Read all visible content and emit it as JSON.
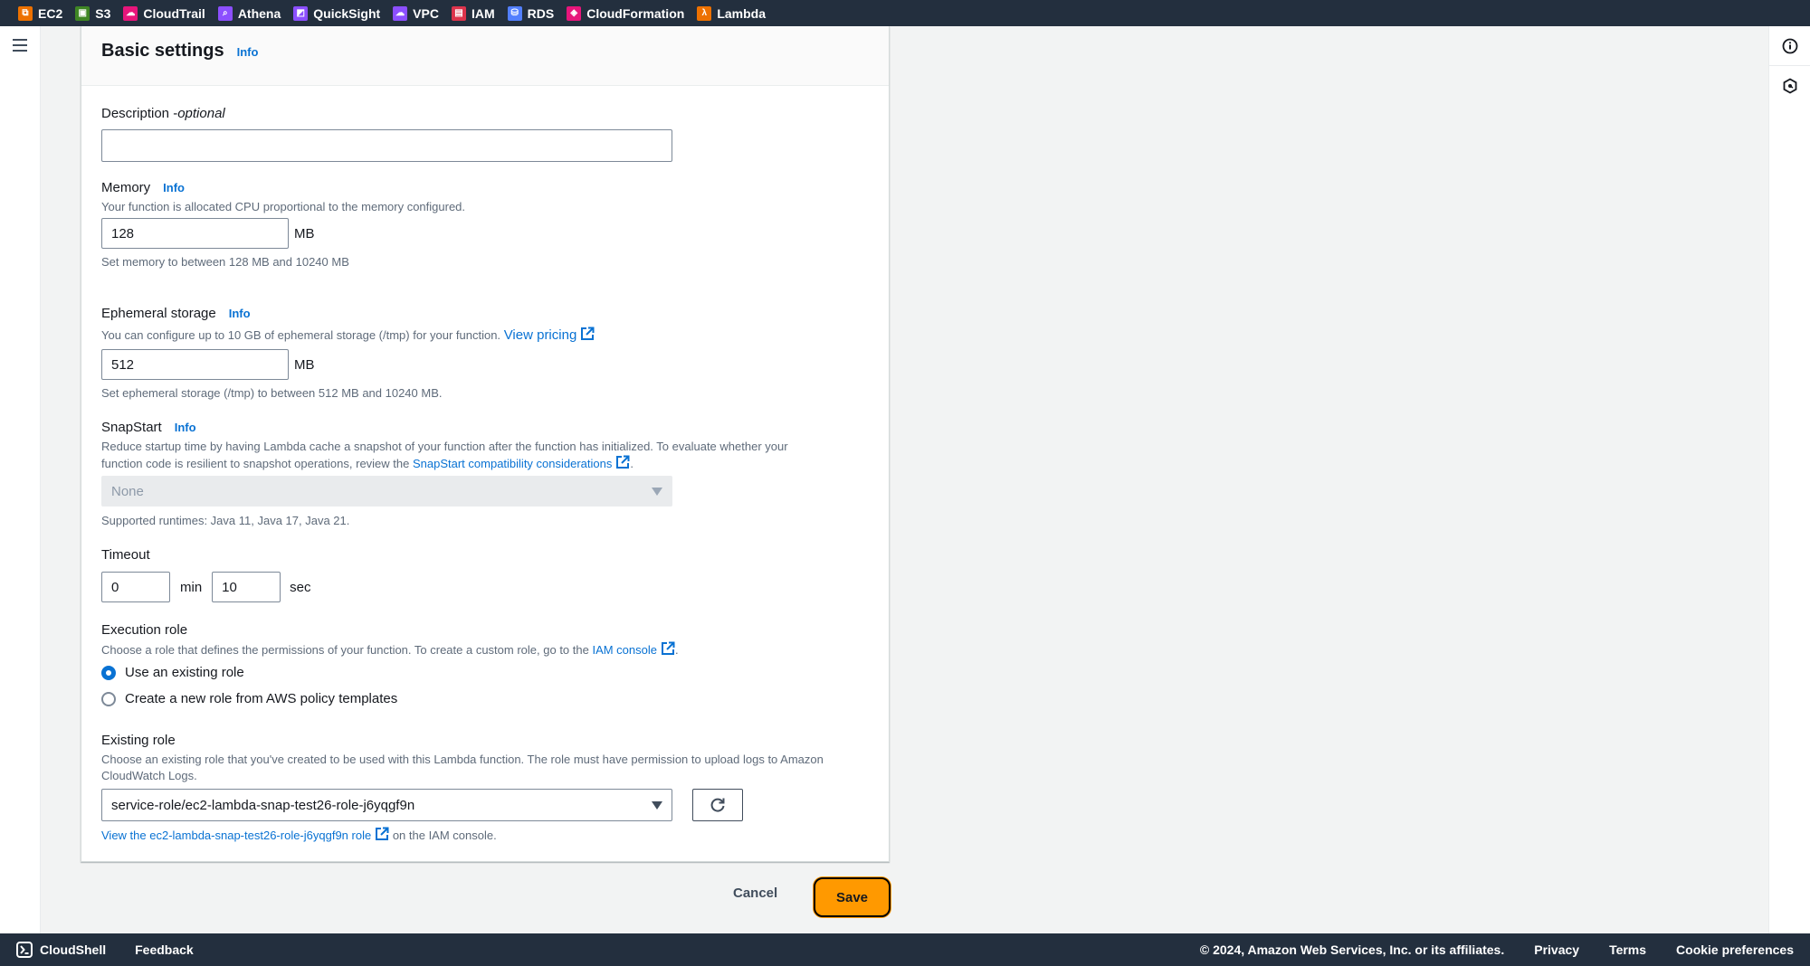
{
  "topbar": {
    "services": [
      {
        "label": "EC2",
        "icon": "ec2-icon",
        "color": "#ed7100"
      },
      {
        "label": "S3",
        "icon": "s3-icon",
        "color": "#3f8624"
      },
      {
        "label": "CloudTrail",
        "icon": "cloudtrail-icon",
        "color": "#e7157b"
      },
      {
        "label": "Athena",
        "icon": "athena-icon",
        "color": "#8c4fff"
      },
      {
        "label": "QuickSight",
        "icon": "quicksight-icon",
        "color": "#8c4fff"
      },
      {
        "label": "VPC",
        "icon": "vpc-icon",
        "color": "#8c4fff"
      },
      {
        "label": "IAM",
        "icon": "iam-icon",
        "color": "#dd344c"
      },
      {
        "label": "RDS",
        "icon": "rds-icon",
        "color": "#527fff"
      },
      {
        "label": "CloudFormation",
        "icon": "cloudformation-icon",
        "color": "#e7157b"
      },
      {
        "label": "Lambda",
        "icon": "lambda-icon",
        "color": "#ed7100"
      }
    ]
  },
  "panel": {
    "title": "Basic settings",
    "info": "Info"
  },
  "description": {
    "label": "Description - ",
    "label_optional": "optional",
    "value": "",
    "placeholder": ""
  },
  "memory": {
    "label": "Memory",
    "info": "Info",
    "desc": "Your function is allocated CPU proportional to the memory configured.",
    "value": "128",
    "unit": "MB",
    "hint": "Set memory to between 128 MB and 10240 MB"
  },
  "ephemeral": {
    "label": "Ephemeral storage",
    "info": "Info",
    "desc": "You can configure up to 10 GB of ephemeral storage (/tmp) for your function.",
    "link": "View pricing",
    "value": "512",
    "unit": "MB",
    "hint": "Set ephemeral storage (/tmp) to between 512 MB and 10240 MB."
  },
  "snapstart": {
    "label": "SnapStart",
    "info": "Info",
    "desc_line1": "Reduce startup time by having Lambda cache a snapshot of your function after the function has initialized. To evaluate whether your",
    "desc_line2": "function code is resilient to snapshot operations, review the ",
    "link": "SnapStart compatibility considerations",
    "desc_end": ".",
    "selected": "None",
    "hint": "Supported runtimes: Java 11, Java 17, Java 21."
  },
  "timeout": {
    "label": "Timeout",
    "min_value": "0",
    "min_unit": "min",
    "sec_value": "10",
    "sec_unit": "sec"
  },
  "execution_role": {
    "label": "Execution role",
    "desc": "Choose a role that defines the permissions of your function. To create a custom role, go to the ",
    "link": "IAM console",
    "desc_end": ".",
    "options": [
      {
        "label": "Use an existing role",
        "checked": true
      },
      {
        "label": "Create a new role from AWS policy templates",
        "checked": false
      }
    ]
  },
  "existing_role": {
    "label": "Existing role",
    "desc_line1": "Choose an existing role that you've created to be used with this Lambda function. The role must have permission to upload logs to Amazon",
    "desc_line2": "CloudWatch Logs.",
    "selected": "service-role/ec2-lambda-snap-test26-role-j6yqgf9n",
    "view_link": "View the ec2-lambda-snap-test26-role-j6yqgf9n role",
    "view_suffix": " on the IAM console."
  },
  "actions": {
    "cancel": "Cancel",
    "save": "Save"
  },
  "footer": {
    "cloudshell": "CloudShell",
    "feedback": "Feedback",
    "copyright": "© 2024, Amazon Web Services, Inc. or its affiliates.",
    "privacy": "Privacy",
    "terms": "Terms",
    "cookies": "Cookie preferences"
  }
}
